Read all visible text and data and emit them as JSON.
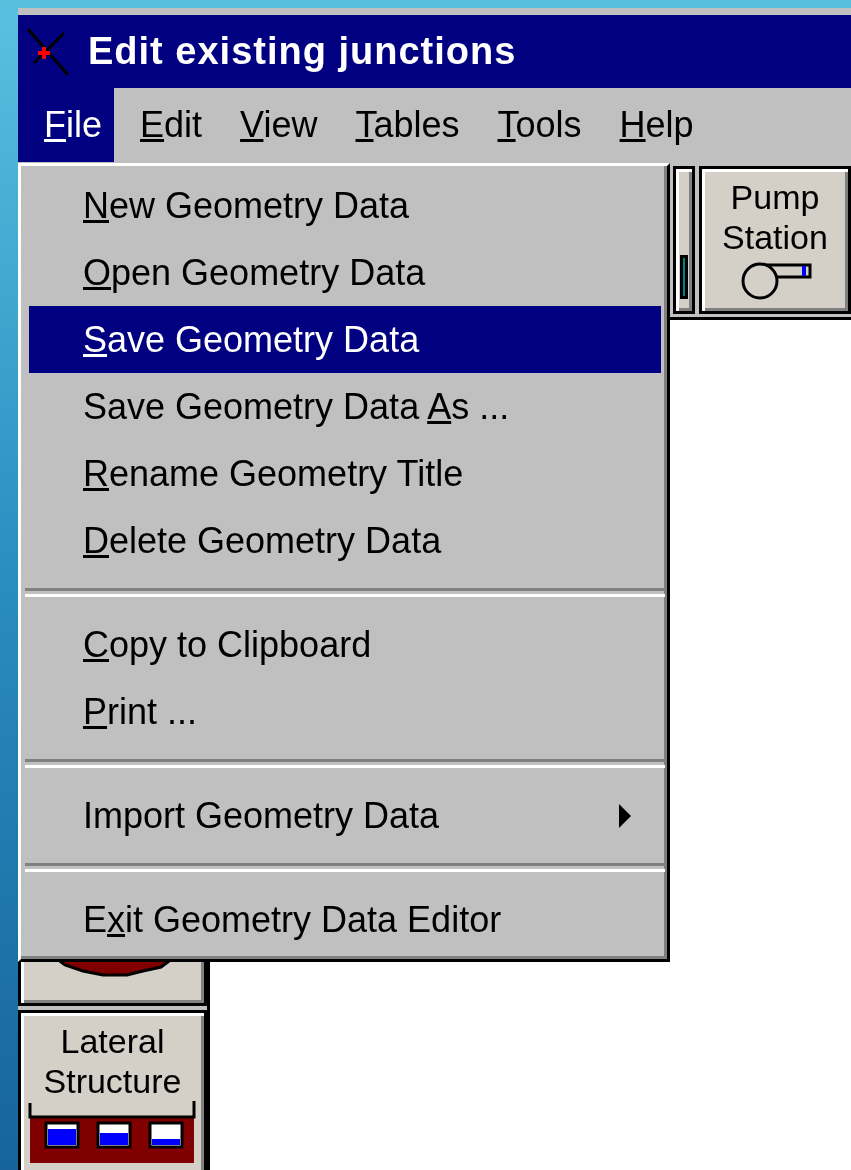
{
  "window": {
    "title": "Edit existing junctions"
  },
  "menu_bar": [
    {
      "key": "F",
      "post": "ile",
      "selected": true
    },
    {
      "key": "E",
      "post": "dit",
      "selected": false
    },
    {
      "key": "V",
      "post": "iew",
      "selected": false
    },
    {
      "key": "T",
      "post": "ables",
      "selected": false
    },
    {
      "key": "T",
      "post": "ools",
      "selected": false
    },
    {
      "key": "H",
      "post": "elp",
      "selected": false
    }
  ],
  "file_menu": [
    {
      "kind": "command",
      "key": "N",
      "post": "ew Geometry Data",
      "selected": false
    },
    {
      "kind": "command",
      "key": "O",
      "post": "pen Geometry Data",
      "selected": false
    },
    {
      "kind": "command",
      "key": "S",
      "post": "ave Geometry Data",
      "selected": true
    },
    {
      "kind": "command",
      "pre": "Save Geometry Data ",
      "key": "A",
      "post": "s ...",
      "selected": false
    },
    {
      "kind": "command",
      "key": "R",
      "post": "ename Geometry Title",
      "selected": false
    },
    {
      "kind": "command",
      "key": "D",
      "post": "elete Geometry Data",
      "selected": false
    },
    {
      "kind": "separator"
    },
    {
      "kind": "command",
      "key": "C",
      "post": "opy to Clipboard",
      "selected": false
    },
    {
      "kind": "command",
      "key": "P",
      "post": "rint ...",
      "selected": false
    },
    {
      "kind": "separator"
    },
    {
      "kind": "submenu",
      "pre": "Import Geometry Data",
      "selected": false
    },
    {
      "kind": "separator"
    },
    {
      "kind": "command",
      "pre": "E",
      "key": "x",
      "post": "it Geometry Data Editor",
      "selected": false
    }
  ],
  "toolbar": [
    {
      "kind": "partial"
    },
    {
      "kind": "pump",
      "label": "Pump Station"
    }
  ],
  "side_buttons": [
    {
      "kind": "partial"
    },
    {
      "kind": "lateral",
      "label": "Lateral Structure"
    }
  ]
}
